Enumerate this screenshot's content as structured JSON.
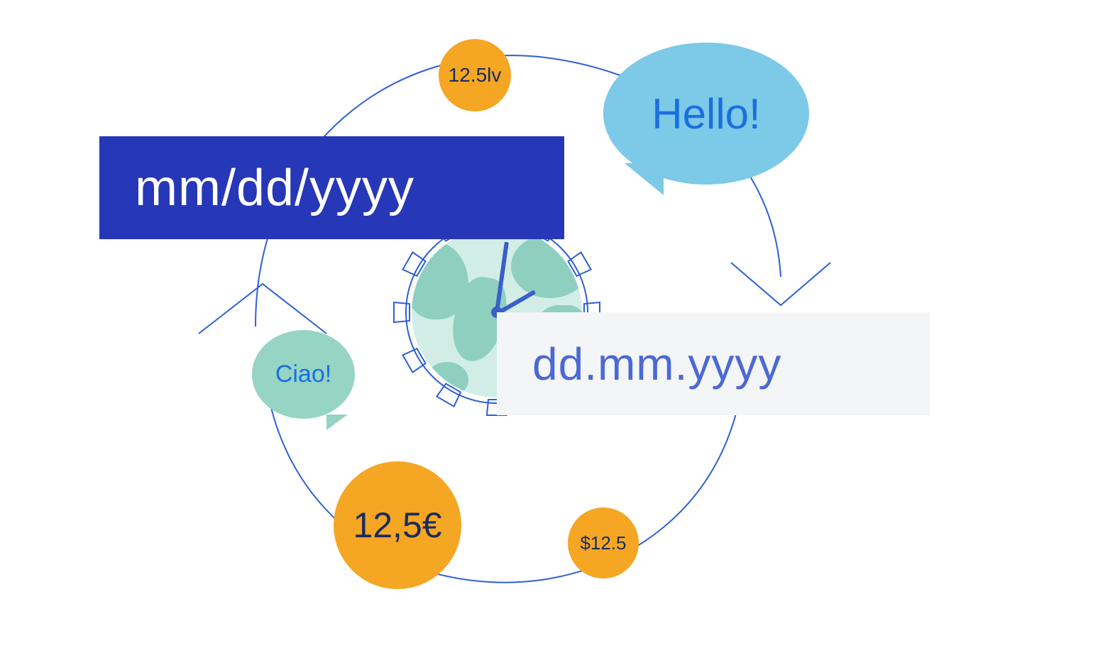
{
  "date_formats": {
    "us": "mm/dd/yyyy",
    "eu": "dd.mm.yyyy"
  },
  "greetings": {
    "hello": "Hello!",
    "ciao": "Ciao!"
  },
  "currency_examples": {
    "lev": "12.5lv",
    "euro": "12,5€",
    "dollar": "$12.5"
  },
  "colors": {
    "arc_stroke": "#2e5fd9",
    "box_dark_bg": "#2637b8",
    "box_light_bg": "#f4f5f7",
    "box_light_fg": "#4a69d4",
    "bubble_blue": "#7cc9e8",
    "bubble_mint": "#96d4c4",
    "bubble_text": "#1a6fe0",
    "coin_bg": "#f5a623",
    "coin_fg": "#1b2b5e",
    "globe_sea": "#d1ede6",
    "globe_land": "#8fcfc0",
    "gear_stroke": "#2e5fd9"
  }
}
